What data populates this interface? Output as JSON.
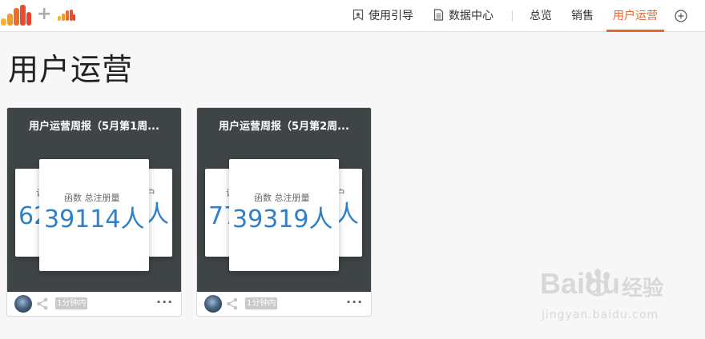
{
  "header": {
    "nav_buttons": [
      {
        "label": "使用引导",
        "icon": "bookmark-star-icon"
      },
      {
        "label": "数据中心",
        "icon": "document-icon"
      }
    ],
    "tabs": [
      {
        "label": "总览",
        "active": false
      },
      {
        "label": "销售",
        "active": false
      },
      {
        "label": "用户运营",
        "active": true
      }
    ],
    "accent_color": "#e5682f"
  },
  "page": {
    "title": "用户运营"
  },
  "cards": [
    {
      "title": "用户运营周报（5月第1周...",
      "slide_back_left": {
        "label": "访",
        "value": "62"
      },
      "slide_front": {
        "label": "函数 总注册量",
        "value": "39114"
      },
      "slide_back_right": {
        "label": "户",
        "value": "人"
      },
      "front_unit": "人",
      "time": "1分钟内"
    },
    {
      "title": "用户运营周报（5月第2周...",
      "slide_back_left": {
        "label": "访",
        "value": "77"
      },
      "slide_front": {
        "label": "函数 总注册量",
        "value": "39319"
      },
      "slide_back_right": {
        "label": "户",
        "value": "人"
      },
      "front_unit": "人",
      "time": "1分钟内"
    }
  ],
  "watermark": {
    "brand": "Baidu",
    "cn": "经验",
    "url": "jingyan.baidu.com"
  }
}
